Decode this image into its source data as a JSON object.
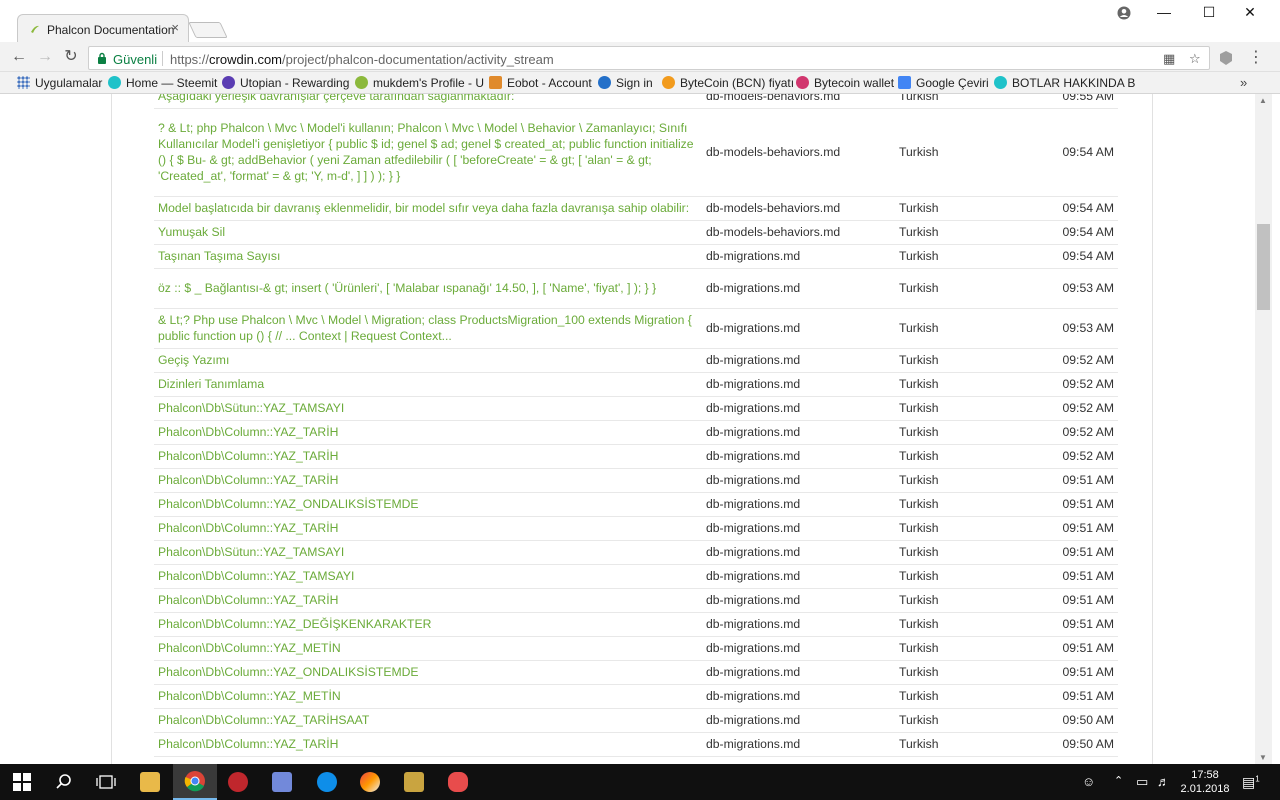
{
  "browser": {
    "tab_title": "Phalcon Documentation",
    "tab_close": "×",
    "security_label": "Güvenli",
    "url_scheme": "https://",
    "url_host": "crowdin.com",
    "url_path": "/project/phalcon-documentation/activity_stream",
    "minimize": "—",
    "maximize": "☐",
    "close": "✕"
  },
  "bookmarks": [
    {
      "label": "Uygulamalar",
      "color": "#4a78c2"
    },
    {
      "label": "Home — Steemit",
      "color": "#1fc2c9"
    },
    {
      "label": "Utopian - Rewarding",
      "color": "#5b3db3"
    },
    {
      "label": "mukdem's Profile - U",
      "color": "#8cb93c"
    },
    {
      "label": "Eobot - Account",
      "color": "#e08a2c"
    },
    {
      "label": "Sign in",
      "color": "#2470c9"
    },
    {
      "label": "ByteCoin (BCN) fiyatı",
      "color": "#f29b1d"
    },
    {
      "label": "Bytecoin wallet",
      "color": "#d1366e"
    },
    {
      "label": "Google Çeviri",
      "color": "#4285f4"
    },
    {
      "label": "BOTLAR HAKKINDA B",
      "color": "#1fc2c9"
    }
  ],
  "activity": [
    {
      "text": "Aşağıdaki yerleşik davranışlar çerçeve tarafından sağlanmaktadır:",
      "file": "db-models-behaviors.md",
      "lang": "Turkish",
      "time": "09:55 AM"
    },
    {
      "text": "? & Lt; php Phalcon \\ Mvc \\ Model'i kullanın; Phalcon \\ Mvc \\ Model \\ Behavior \\ Zamanlayıcı; Sınıfı Kullanıcılar Model'i genişletiyor {      public $ id;      genel $ ad;      genel $ created_at;      public function initialize ()      {          $ Bu- & gt; addBehavior (              yeni Zaman atfedilebilir (                  [                      'beforeCreate' = & gt; [                          'alan' = & gt; 'Created_at',                          'format' = & gt; 'Y, m-d',                      ]                  ]              )          );      } }",
      "file": "db-models-behaviors.md",
      "lang": "Turkish",
      "time": "09:54 AM"
    },
    {
      "text": "Model başlatıcıda bir davranış eklenmelidir, bir model sıfır veya daha fazla davranışa sahip olabilir:",
      "file": "db-models-behaviors.md",
      "lang": "Turkish",
      "time": "09:54 AM"
    },
    {
      "text": "Yumuşak Sil",
      "file": "db-models-behaviors.md",
      "lang": "Turkish",
      "time": "09:54 AM"
    },
    {
      "text": "Taşınan Taşıma Sayısı",
      "file": "db-migrations.md",
      "lang": "Turkish",
      "time": "09:54 AM"
    },
    {
      "text": "öz :: $ _ Bağlantısı-& gt; insert (              'Ürünleri',              [                  'Malabar ıspanağı'                  14.50,              ],              [                  'Name',                  'fiyat',              ]          );      } }",
      "file": "db-migrations.md",
      "lang": "Turkish",
      "time": "09:53 AM"
    },
    {
      "text": "& Lt;? Php use Phalcon \\ Mvc \\ Model \\ Migration; class ProductsMigration_100 extends Migration {      public function up ()      {          // ...   Context | Request Context...",
      "file": "db-migrations.md",
      "lang": "Turkish",
      "time": "09:53 AM"
    },
    {
      "text": "Geçiş Yazımı",
      "file": "db-migrations.md",
      "lang": "Turkish",
      "time": "09:52 AM"
    },
    {
      "text": "Dizinleri Tanımlama",
      "file": "db-migrations.md",
      "lang": "Turkish",
      "time": "09:52 AM"
    },
    {
      "text": "Phalcon\\Db\\Sütun::YAZ_TAMSAYI",
      "file": "db-migrations.md",
      "lang": "Turkish",
      "time": "09:52 AM"
    },
    {
      "text": "Phalcon\\Db\\Column::YAZ_TARİH",
      "file": "db-migrations.md",
      "lang": "Turkish",
      "time": "09:52 AM"
    },
    {
      "text": "Phalcon\\Db\\Column::YAZ_TARİH",
      "file": "db-migrations.md",
      "lang": "Turkish",
      "time": "09:52 AM"
    },
    {
      "text": "Phalcon\\Db\\Column::YAZ_TARİH",
      "file": "db-migrations.md",
      "lang": "Turkish",
      "time": "09:51 AM"
    },
    {
      "text": "Phalcon\\Db\\Column::YAZ_ONDALIKSİSTEMDE",
      "file": "db-migrations.md",
      "lang": "Turkish",
      "time": "09:51 AM"
    },
    {
      "text": "Phalcon\\Db\\Column::YAZ_TARİH",
      "file": "db-migrations.md",
      "lang": "Turkish",
      "time": "09:51 AM"
    },
    {
      "text": "Phalcon\\Db\\Sütun::YAZ_TAMSAYI",
      "file": "db-migrations.md",
      "lang": "Turkish",
      "time": "09:51 AM"
    },
    {
      "text": "Phalcon\\Db\\Column::YAZ_TAMSAYI",
      "file": "db-migrations.md",
      "lang": "Turkish",
      "time": "09:51 AM"
    },
    {
      "text": "Phalcon\\Db\\Column::YAZ_TARİH",
      "file": "db-migrations.md",
      "lang": "Turkish",
      "time": "09:51 AM"
    },
    {
      "text": "Phalcon\\Db\\Column::YAZ_DEĞİŞKENKARAKTER",
      "file": "db-migrations.md",
      "lang": "Turkish",
      "time": "09:51 AM"
    },
    {
      "text": "Phalcon\\Db\\Column::YAZ_METİN",
      "file": "db-migrations.md",
      "lang": "Turkish",
      "time": "09:51 AM"
    },
    {
      "text": "Phalcon\\Db\\Column::YAZ_ONDALIKSİSTEMDE",
      "file": "db-migrations.md",
      "lang": "Turkish",
      "time": "09:51 AM"
    },
    {
      "text": "Phalcon\\Db\\Column::YAZ_METİN",
      "file": "db-migrations.md",
      "lang": "Turkish",
      "time": "09:51 AM"
    },
    {
      "text": "Phalcon\\Db\\Column::YAZ_TARİHSAAT",
      "file": "db-migrations.md",
      "lang": "Turkish",
      "time": "09:50 AM"
    },
    {
      "text": "Phalcon\\Db\\Column::YAZ_TARİH",
      "file": "db-migrations.md",
      "lang": "Turkish",
      "time": "09:50 AM"
    }
  ],
  "taskbar": {
    "time": "17:58",
    "date": "2.01.2018",
    "notification_count": "1"
  },
  "colors": {
    "link_green": "#6bab3a",
    "secure_green": "#0b8043",
    "taskbar": "#101010"
  }
}
